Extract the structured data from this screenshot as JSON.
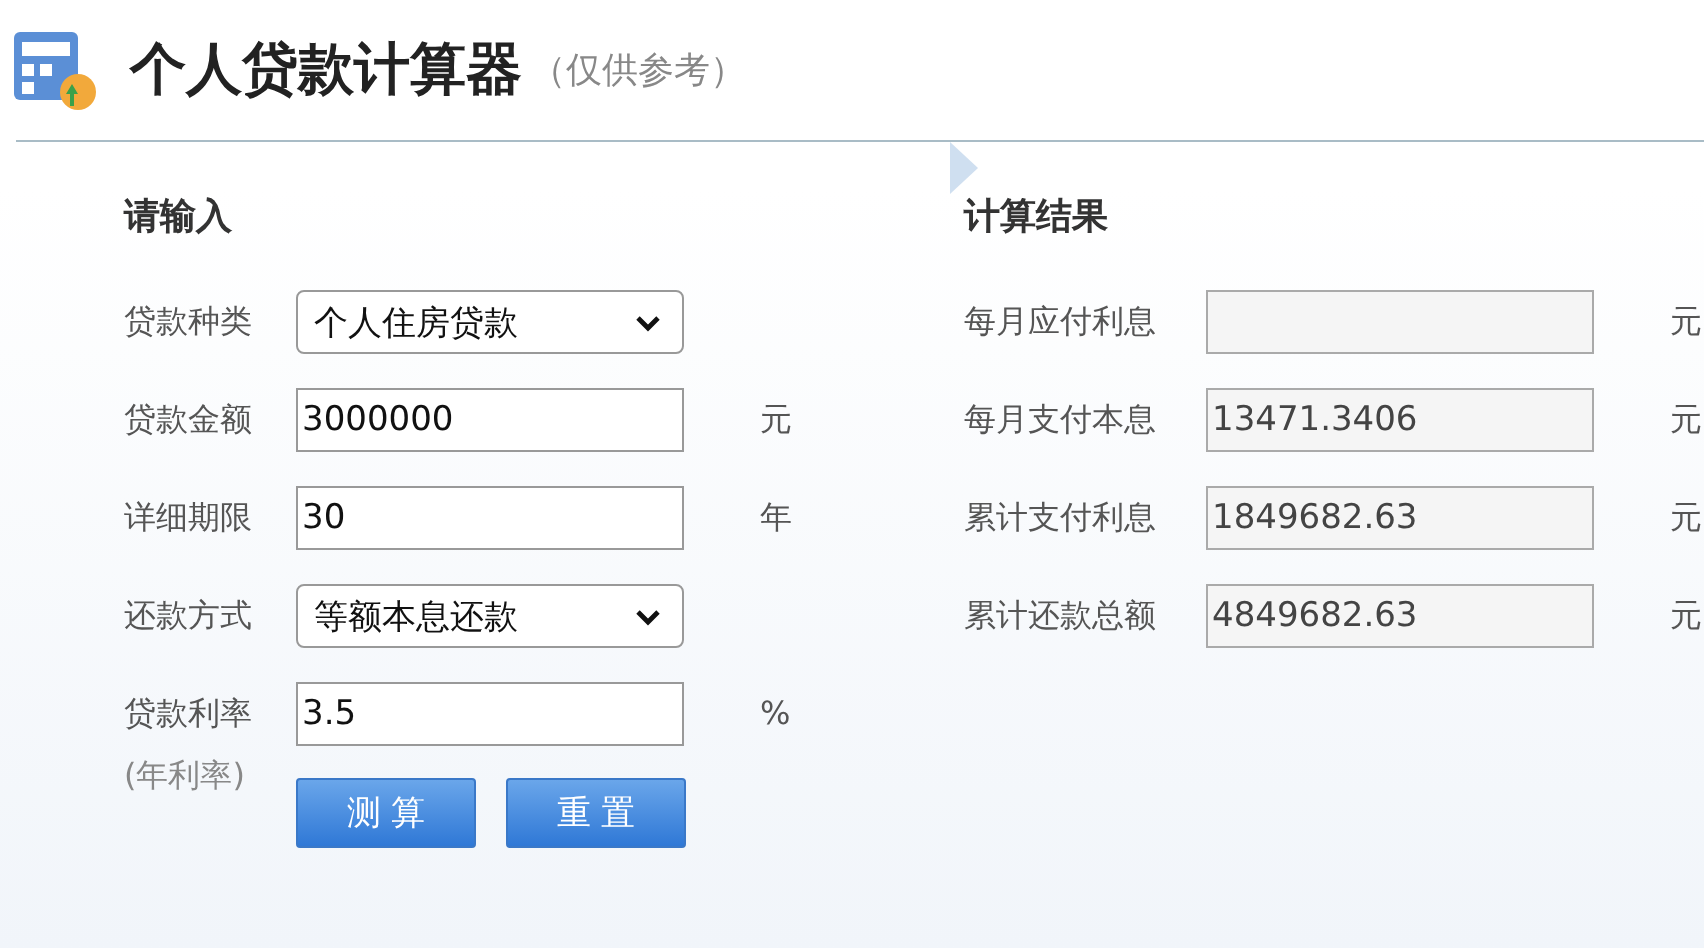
{
  "header": {
    "title": "个人贷款计算器",
    "subtitle": "（仅供参考）"
  },
  "input": {
    "heading": "请输入",
    "rows": [
      {
        "label": "贷款种类",
        "kind": "select",
        "value": "个人住房贷款"
      },
      {
        "label": "贷款金额",
        "kind": "input",
        "value": "3000000",
        "unit": "元"
      },
      {
        "label": "详细期限",
        "kind": "input",
        "value": "30",
        "unit": "年"
      },
      {
        "label": "还款方式",
        "kind": "select",
        "value": "等额本息还款"
      },
      {
        "label": "贷款利率",
        "note": "(年利率)",
        "kind": "input",
        "value": "3.5",
        "unit": "%"
      }
    ],
    "buttons": [
      "测 算",
      "重 置"
    ]
  },
  "result": {
    "heading": "计算结果",
    "rows": [
      {
        "label": "每月应付利息",
        "unit": "元"
      },
      {
        "label": "每月支付本息",
        "value": "13471.3406",
        "unit": "元"
      },
      {
        "label": "累计支付利息",
        "value": "1849682.63",
        "unit": "元"
      },
      {
        "label": "累计还款总额",
        "value": "4849682.63",
        "unit": "元"
      }
    ]
  }
}
